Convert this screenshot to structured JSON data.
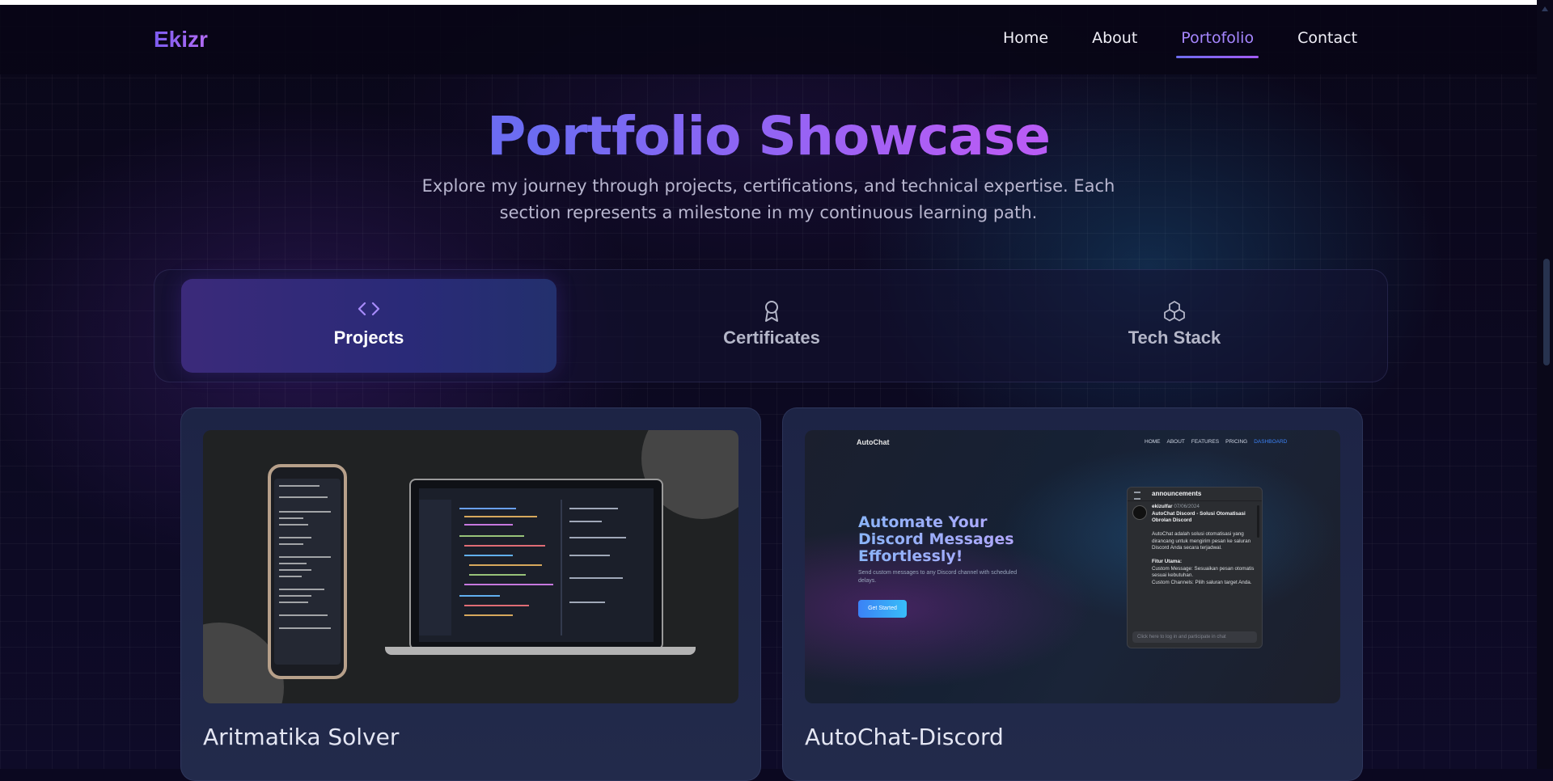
{
  "nav": {
    "logo": "Ekizr",
    "links": [
      {
        "label": "Home"
      },
      {
        "label": "About"
      },
      {
        "label": "Portofolio",
        "active": true
      },
      {
        "label": "Contact"
      }
    ]
  },
  "hero": {
    "title": "Portfolio Showcase",
    "subtitle": "Explore my journey through projects, certifications, and technical expertise. Each section represents a milestone in my continuous learning path."
  },
  "tabs": [
    {
      "label": "Projects",
      "icon": "code-icon",
      "active": true
    },
    {
      "label": "Certificates",
      "icon": "award-icon",
      "active": false
    },
    {
      "label": "Tech Stack",
      "icon": "boxes-icon",
      "active": false
    }
  ],
  "projects": [
    {
      "title": "Aritmatika Solver"
    },
    {
      "title": "AutoChat-Discord",
      "preview": {
        "logo": "AutoChat",
        "nav": [
          "HOME",
          "ABOUT",
          "FEATURES",
          "PRICING",
          "DASHBOARD"
        ],
        "headline": "Automate Your Discord Messages Effortlessly!",
        "sub": "Send custom messages to any Discord channel with scheduled delays.",
        "button": "Get Started",
        "channel": "announcements",
        "author": "ekizulfar",
        "date": "07/06/2024",
        "msg_title": "AutoChat Discord - Solusi Otomatisasi Obrolan Discord",
        "msg_body": "AutoChat adalah solusi otomatisasi yang dirancang untuk mengirim pesan ke saluran Discord Anda secara terjadwal.",
        "msg_filter": "Fitur Utama:",
        "msg_f1": "Custom Message: Sesuaikan pesan otomatis sesuai kebutuhan.",
        "msg_f2": "Custom Channels: Pilih saluran target Anda.",
        "input_placeholder": "Click here to log in and participate in chat"
      }
    }
  ],
  "colors": {
    "accent": "#8b5cf6",
    "active_link": "#a686ff",
    "background": "#0b0820",
    "card": "#1d2445"
  }
}
